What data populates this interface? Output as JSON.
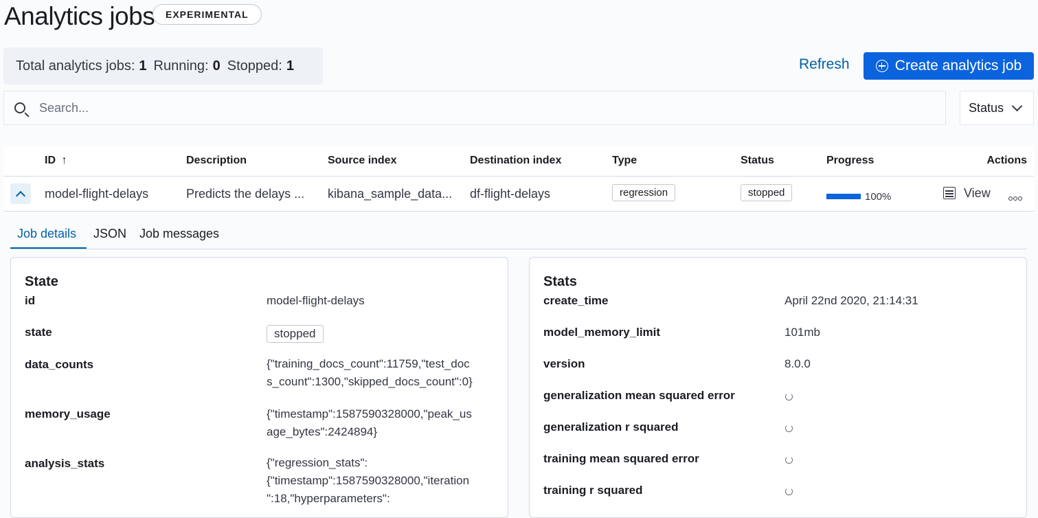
{
  "header": {
    "title": "Analytics jobs",
    "badge": "EXPERIMENTAL"
  },
  "summary": {
    "total_label": "Total analytics jobs:",
    "total": "1",
    "running_label": "Running:",
    "running": "0",
    "stopped_label": "Stopped:",
    "stopped": "1"
  },
  "actions": {
    "refresh": "Refresh",
    "create": "Create analytics job"
  },
  "search": {
    "placeholder": "Search..."
  },
  "filter": {
    "status_label": "Status"
  },
  "table": {
    "columns": {
      "id": "ID",
      "description": "Description",
      "source_index": "Source index",
      "destination_index": "Destination index",
      "type": "Type",
      "status": "Status",
      "progress": "Progress",
      "actions": "Actions"
    },
    "sort_indicator": "↑",
    "rows": [
      {
        "id": "model-flight-delays",
        "description": "Predicts the delays ...",
        "source_index": "kibana_sample_data...",
        "destination_index": "df-flight-delays",
        "type": "regression",
        "status": "stopped",
        "progress_text": "100%",
        "progress_fraction": 1.0,
        "view_label": "View"
      }
    ]
  },
  "tabs": [
    "Job details",
    "JSON",
    "Job messages"
  ],
  "state_panel": {
    "title": "State",
    "rows": [
      {
        "key": "id",
        "value": "model-flight-delays"
      },
      {
        "key": "state",
        "value": "stopped"
      },
      {
        "key": "data_counts",
        "value_lines": [
          "{\"training_docs_count\":11759,\"test_doc",
          "s_count\":1300,\"skipped_docs_count\":0}"
        ]
      },
      {
        "key": "memory_usage",
        "value_lines": [
          "{\"timestamp\":1587590328000,\"peak_us",
          "age_bytes\":2424894}"
        ]
      },
      {
        "key": "analysis_stats",
        "value_lines": [
          "{\"regression_stats\":",
          "{\"timestamp\":1587590328000,\"iteration",
          "\":18,\"hyperparameters\":"
        ]
      }
    ]
  },
  "stats_panel": {
    "title": "Stats",
    "rows": [
      {
        "key": "create_time",
        "value": "April 22nd 2020, 21:14:31"
      },
      {
        "key": "model_memory_limit",
        "value": "101mb"
      },
      {
        "key": "version",
        "value": "8.0.0"
      },
      {
        "key": "generalization mean squared error",
        "value": ""
      },
      {
        "key": "generalization r squared",
        "value": ""
      },
      {
        "key": "training mean squared error",
        "value": ""
      },
      {
        "key": "training r squared",
        "value": ""
      }
    ]
  },
  "icons": [
    "plus-circle-icon",
    "search-icon",
    "chevron-down-icon",
    "sort-asc-icon",
    "chevron-up-icon",
    "table-view-icon",
    "more-actions-icon",
    "loading-spinner-icon"
  ],
  "colors": {
    "primary": "#0b64dd",
    "link": "#0061a6",
    "background": "#fafbfd"
  }
}
